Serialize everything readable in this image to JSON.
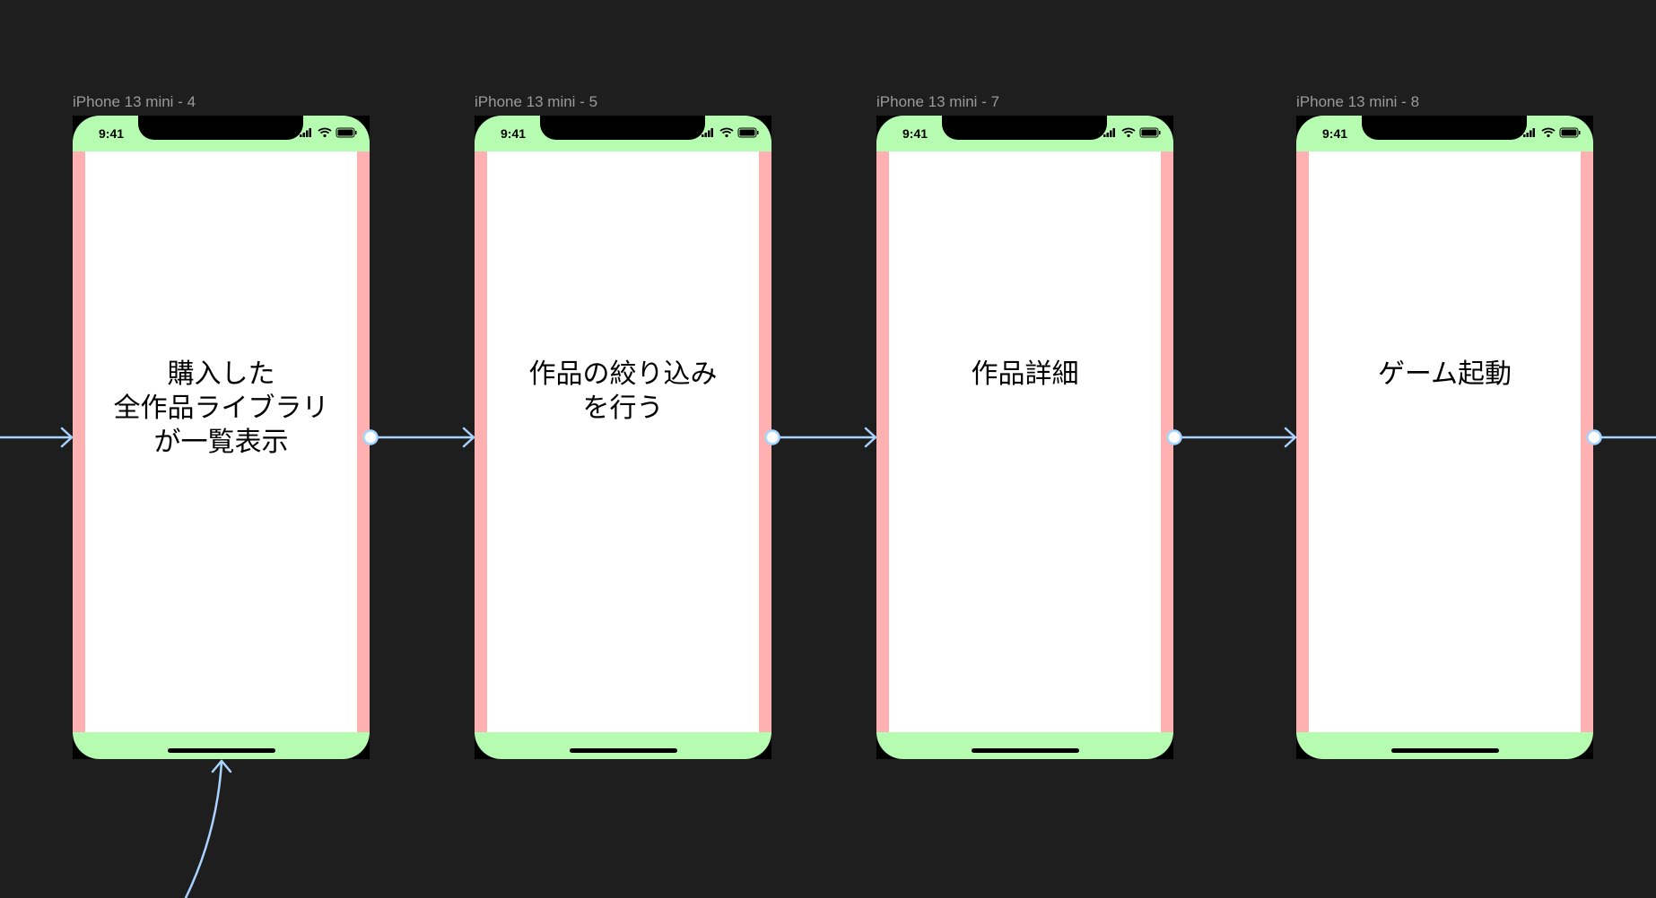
{
  "frames": [
    {
      "label": "iPhone 13 mini - 4",
      "time": "9:41",
      "text": "購入した\n全作品ライブラリ\nが一覧表示"
    },
    {
      "label": "iPhone 13 mini - 5",
      "time": "9:41",
      "text": "作品の絞り込み\nを行う"
    },
    {
      "label": "iPhone 13 mini - 7",
      "time": "9:41",
      "text": "作品詳細"
    },
    {
      "label": "iPhone 13 mini - 8",
      "time": "9:41",
      "text": "ゲーム起動"
    }
  ],
  "colors": {
    "canvas": "#1e1e1e",
    "status_area": "#b6fcb0",
    "side_margin": "#ffb1b1",
    "screen": "#ffffff",
    "connector": "#a8d3ff",
    "frame_label": "#9a9a9a"
  },
  "icons": [
    "cellular-signal-icon",
    "wifi-icon",
    "battery-icon"
  ]
}
